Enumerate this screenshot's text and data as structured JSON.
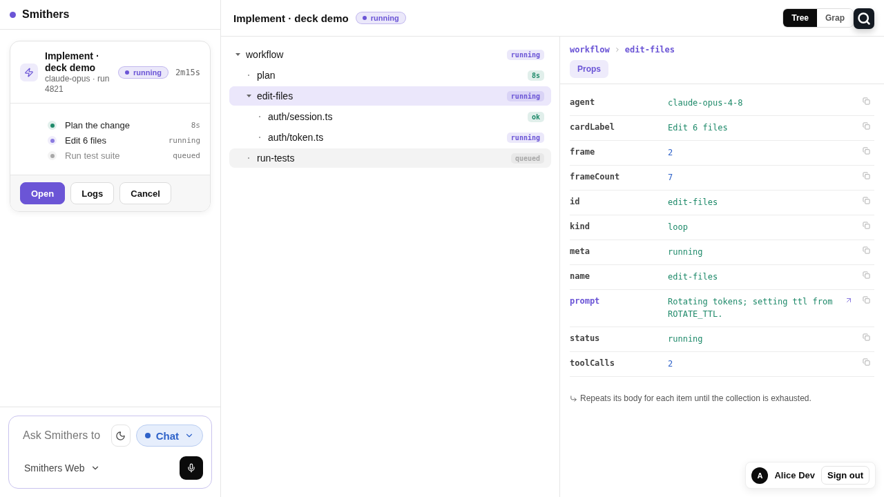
{
  "sidebar": {
    "brand": "Smithers",
    "run_card": {
      "title": "Implement · deck demo",
      "subtitle": "claude-opus · run 4821",
      "status": {
        "label": "running",
        "color": "#6b55d6"
      },
      "elapsed": "2m15s",
      "steps": [
        {
          "label": "Plan the change",
          "meta": "8s",
          "color": "#1f8a6a",
          "dimmed": false
        },
        {
          "label": "Edit 6 files",
          "meta": "running",
          "color": "#8b7be0",
          "dimmed": false
        },
        {
          "label": "Run test suite",
          "meta": "queued",
          "color": "#a8a8a8",
          "dimmed": true
        }
      ],
      "actions": [
        {
          "label": "Open",
          "primary": true
        },
        {
          "label": "Logs",
          "primary": false
        },
        {
          "label": "Cancel",
          "primary": false
        }
      ]
    },
    "composer": {
      "placeholder": "Ask Smithers to",
      "mode": "Chat",
      "project": "Smithers Web"
    }
  },
  "header": {
    "title": "Implement · deck demo",
    "status": {
      "label": "running",
      "color": "#6b55d6"
    },
    "view_tabs": [
      {
        "label": "Tree",
        "selected": true
      },
      {
        "label": "Grap",
        "selected": false
      }
    ]
  },
  "tree": [
    {
      "label": "workflow",
      "badge": {
        "label": "running",
        "color": "#6b55d6"
      },
      "expanded": true,
      "selected": false,
      "highlighted": false,
      "children": [
        {
          "label": "plan",
          "badge": {
            "label": "8s",
            "color": "#1f8a6a"
          },
          "selected": false,
          "highlighted": false
        },
        {
          "label": "edit-files",
          "badge": {
            "label": "running",
            "color": "#6b55d6"
          },
          "expanded": true,
          "selected": true,
          "highlighted": false,
          "children": [
            {
              "label": "auth/session.ts",
              "badge": {
                "label": "ok",
                "color": "#1f8a6a"
              },
              "selected": false,
              "highlighted": false
            },
            {
              "label": "auth/token.ts",
              "badge": {
                "label": "running",
                "color": "#6b55d6"
              },
              "selected": false,
              "highlighted": false
            }
          ]
        },
        {
          "label": "run-tests",
          "badge": {
            "label": "queued",
            "color": "#a8a8a8"
          },
          "selected": false,
          "highlighted": true
        }
      ]
    }
  ],
  "inspector": {
    "breadcrumb": [
      "workflow",
      "edit-files"
    ],
    "tabs": [
      {
        "label": "Props",
        "selected": true
      }
    ],
    "props": [
      {
        "key": "agent",
        "value": "claude-opus-4-8",
        "numeric": false,
        "linked": false
      },
      {
        "key": "cardLabel",
        "value": "Edit 6 files",
        "numeric": false,
        "linked": false
      },
      {
        "key": "frame",
        "value": "2",
        "numeric": true,
        "linked": false
      },
      {
        "key": "frameCount",
        "value": "7",
        "numeric": true,
        "linked": false
      },
      {
        "key": "id",
        "value": "edit-files",
        "numeric": false,
        "linked": false
      },
      {
        "key": "kind",
        "value": "loop",
        "numeric": false,
        "linked": false
      },
      {
        "key": "meta",
        "value": "running",
        "numeric": false,
        "linked": false
      },
      {
        "key": "name",
        "value": "edit-files",
        "numeric": false,
        "linked": false
      },
      {
        "key": "prompt",
        "value": "Rotating tokens; setting ttl from ROTATE_TTL.",
        "numeric": false,
        "linked": true
      },
      {
        "key": "status",
        "value": "running",
        "numeric": false,
        "linked": false
      },
      {
        "key": "toolCalls",
        "value": "2",
        "numeric": true,
        "linked": false
      }
    ],
    "note": "Repeats its body for each item until the collection is exhausted."
  },
  "user": {
    "initial": "A",
    "name": "Alice Dev",
    "sign_out": "Sign out"
  }
}
